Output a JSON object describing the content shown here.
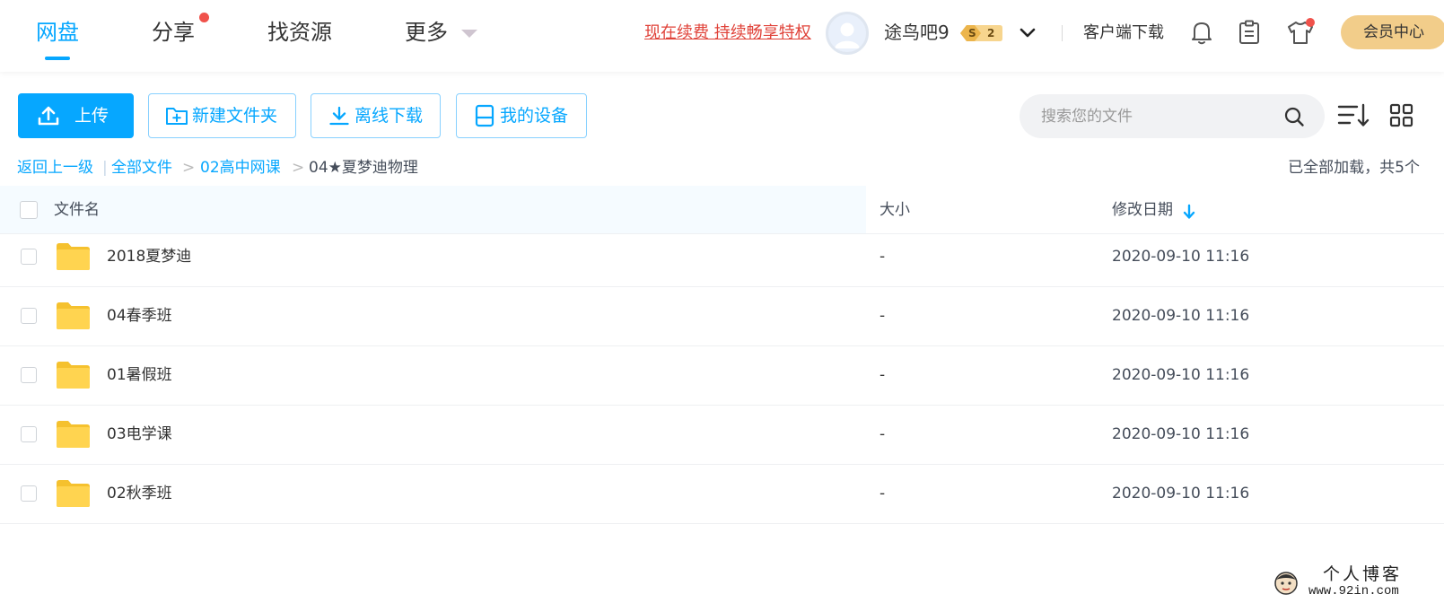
{
  "nav": {
    "items": [
      {
        "label": "网盘",
        "active": true
      },
      {
        "label": "分享",
        "notification": true
      },
      {
        "label": "找资源"
      },
      {
        "label": "更多"
      }
    ]
  },
  "header": {
    "renew_link": "现在续费 持续畅享特权",
    "username": "途鸟吧9",
    "badge": {
      "left": "S",
      "right": "2"
    },
    "client_download": "客户端下载",
    "vip_center": "会员中心",
    "icons": [
      "bell-icon",
      "clipboard-icon",
      "tshirt-icon",
      "chevron-down-icon"
    ]
  },
  "toolbar": {
    "upload": "上传",
    "new_folder": "新建文件夹",
    "offline_download": "离线下载",
    "my_devices": "我的设备",
    "search_placeholder": "搜索您的文件",
    "icons": [
      "upload-icon",
      "new-folder-icon",
      "download-icon",
      "device-icon",
      "search-icon",
      "sort-icon",
      "grid-view-icon"
    ]
  },
  "breadcrumb": {
    "back": "返回上一级",
    "items": [
      "全部文件",
      "02高中网课",
      "04★夏梦迪物理"
    ],
    "separator": ">",
    "loaded_info": "已全部加载，共5个"
  },
  "table": {
    "headers": {
      "name": "文件名",
      "size": "大小",
      "modified": "修改日期"
    },
    "rows": [
      {
        "name": "2018夏梦迪",
        "size": "-",
        "modified": "2020-09-10 11:16"
      },
      {
        "name": "04春季班",
        "size": "-",
        "modified": "2020-09-10 11:16"
      },
      {
        "name": "01暑假班",
        "size": "-",
        "modified": "2020-09-10 11:16"
      },
      {
        "name": "03电学课",
        "size": "-",
        "modified": "2020-09-10 11:16"
      },
      {
        "name": "02秋季班",
        "size": "-",
        "modified": "2020-09-10 11:16"
      }
    ]
  },
  "watermark": {
    "title": "个人博客",
    "url": "www.92in.com"
  },
  "colors": {
    "accent": "#06a7ff",
    "alert": "#e0433a",
    "vip_gold": "#f2cd8a",
    "folder": "#ffd04c"
  }
}
